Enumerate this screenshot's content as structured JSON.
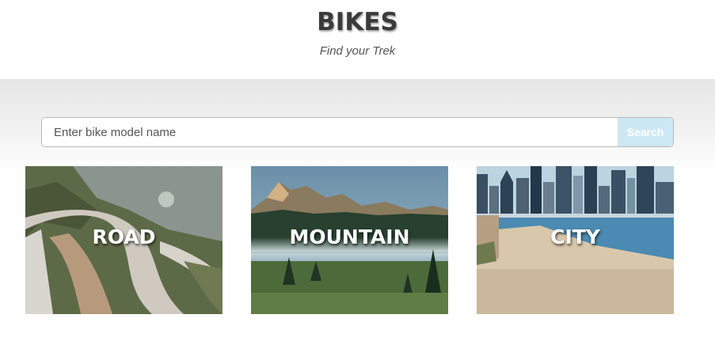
{
  "header": {
    "title": "BIKES",
    "subtitle": "Find your Trek"
  },
  "search": {
    "placeholder": "Enter bike model name",
    "button_label": "Search"
  },
  "categories": [
    {
      "label": "ROAD",
      "image": "mountain-road-photo"
    },
    {
      "label": "MOUNTAIN",
      "image": "alpine-forest-photo"
    },
    {
      "label": "CITY",
      "image": "city-waterfront-photo"
    }
  ],
  "colors": {
    "search_button_bg": "#cde8f5",
    "title_text": "#3b3b3b"
  }
}
